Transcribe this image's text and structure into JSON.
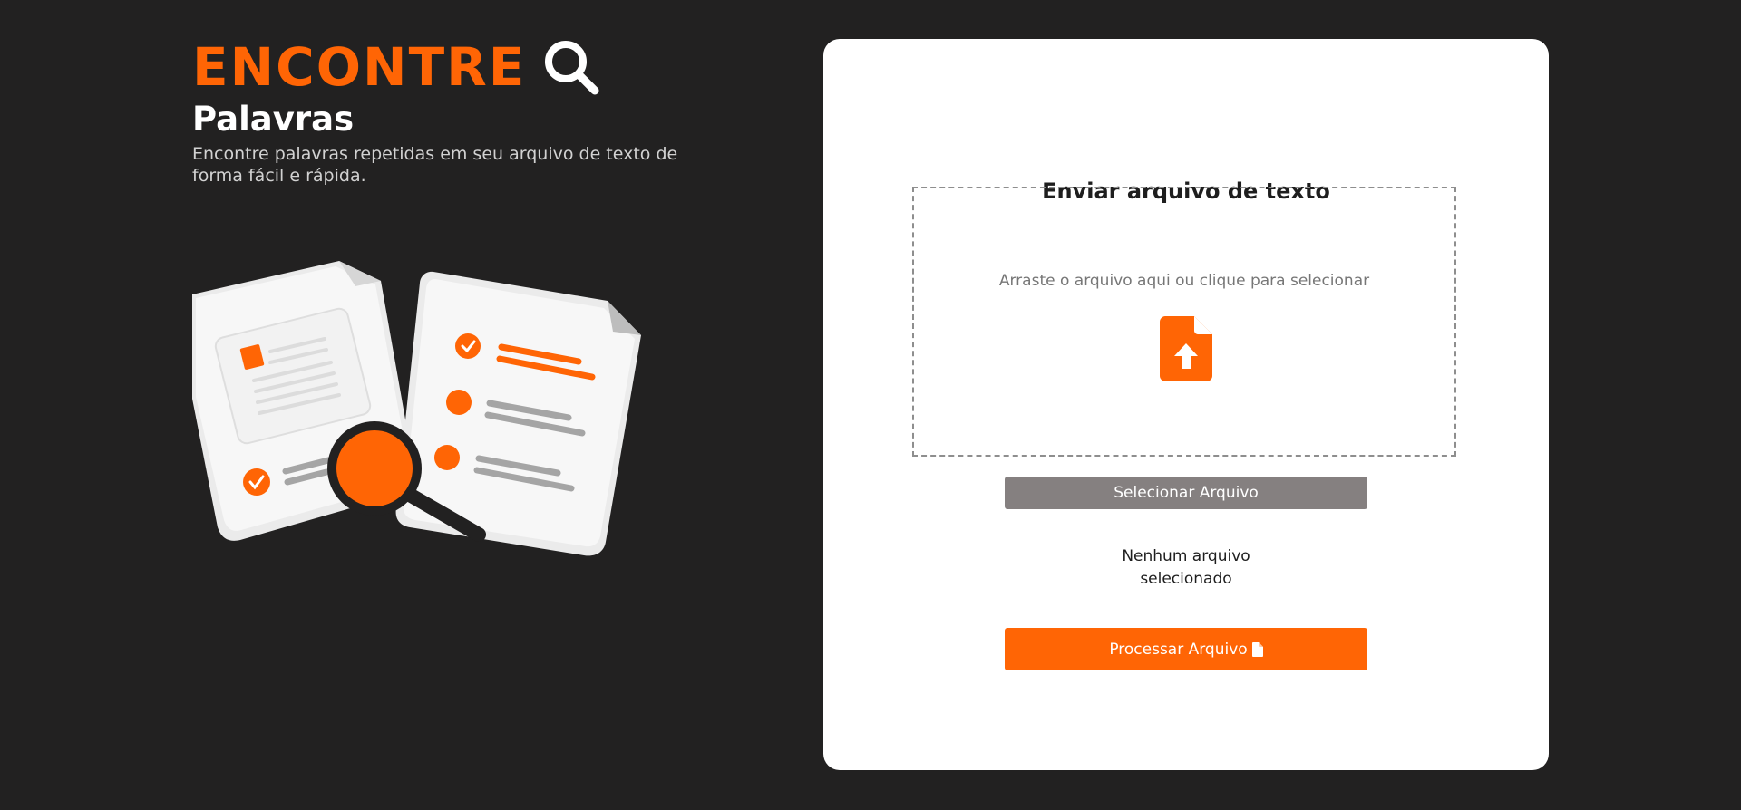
{
  "header": {
    "brand": "ENCONTRE",
    "subtitle": "Palavras",
    "tagline": "Encontre palavras repetidas em seu arquivo de texto de forma fácil e rápida."
  },
  "upload": {
    "title": "Enviar arquivo de texto",
    "dropzone_text": "Arraste o arquivo aqui ou clique para selecionar",
    "select_button": "Selecionar Arquivo",
    "file_status": "Nenhum arquivo selecionado",
    "process_button": "Processar Arquivo"
  },
  "icons": {
    "brand": "search-icon",
    "dropzone": "file-upload-icon",
    "process": "file-icon"
  },
  "colors": {
    "accent": "#ff6505",
    "background": "#222121",
    "card": "#ffffff",
    "select_button": "#858080"
  }
}
